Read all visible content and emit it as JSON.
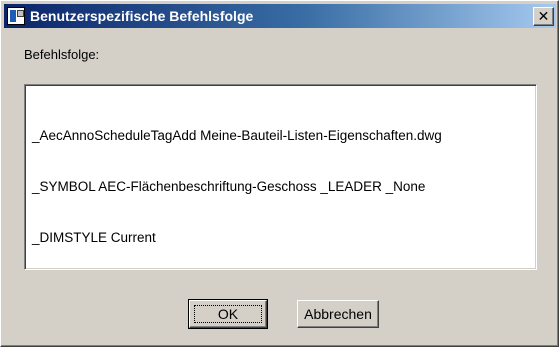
{
  "window": {
    "title": "Benutzerspezifische Befehlsfolge",
    "close_label": "✕"
  },
  "form": {
    "label": "Befehlsfolge:",
    "lines": [
      "_AecAnnoScheduleTagAdd Meine-Bauteil-Listen-Eigenschaften.dwg",
      "_SYMBOL AEC-Flächenbeschriftung-Geschoss _LEADER _None",
      "_DIMSTYLE Current"
    ]
  },
  "buttons": {
    "ok_label": "OK",
    "cancel_label": "Abbrechen"
  },
  "icons": {
    "app": "app-icon",
    "close": "close-icon"
  }
}
